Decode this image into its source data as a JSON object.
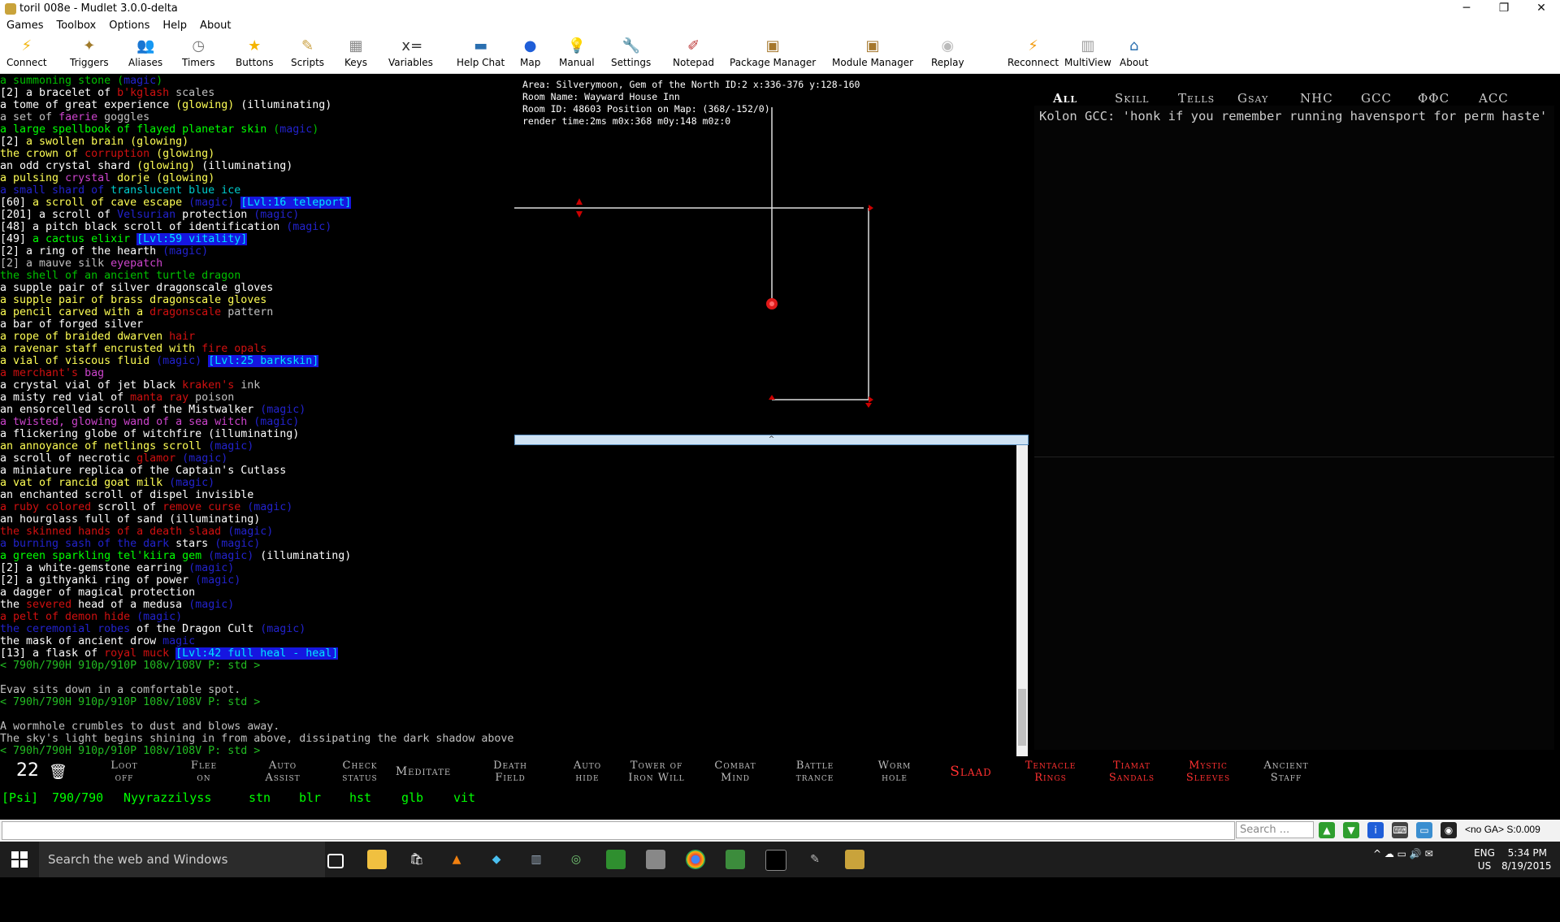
{
  "window": {
    "title": "toril 008e - Mudlet 3.0.0-delta",
    "minimize": "─",
    "maximize": "❐",
    "close": "✕"
  },
  "menu": [
    "Games",
    "Toolbox",
    "Options",
    "Help",
    "About"
  ],
  "toolbar": [
    {
      "label": "Connect",
      "icon": "connect-icon",
      "glyph": "⚡",
      "color": "#f2b40c"
    },
    {
      "label": "Triggers",
      "icon": "triggers-icon",
      "glyph": "✦",
      "color": "#a07a2a"
    },
    {
      "label": "Aliases",
      "icon": "aliases-icon",
      "glyph": "👥",
      "color": "#b88a60"
    },
    {
      "label": "Timers",
      "icon": "timers-icon",
      "glyph": "◷",
      "color": "#777"
    },
    {
      "label": "Buttons",
      "icon": "buttons-icon",
      "glyph": "★",
      "color": "#f4b400"
    },
    {
      "label": "Scripts",
      "icon": "scripts-icon",
      "glyph": "✎",
      "color": "#caa040"
    },
    {
      "label": "Keys",
      "icon": "keys-icon",
      "glyph": "▦",
      "color": "#888"
    },
    {
      "label": "Variables",
      "icon": "variables-icon",
      "glyph": "x=",
      "color": "#333"
    },
    {
      "label": "Help Chat",
      "icon": "help-chat-icon",
      "glyph": "▬",
      "color": "#2a6fb0"
    },
    {
      "label": "Map",
      "icon": "map-icon",
      "glyph": "●",
      "color": "#1f5ed8"
    },
    {
      "label": "Manual",
      "icon": "manual-icon",
      "glyph": "💡",
      "color": "#f2c200"
    },
    {
      "label": "Settings",
      "icon": "settings-icon",
      "glyph": "🔧",
      "color": "#999"
    },
    {
      "label": "Notepad",
      "icon": "notepad-icon",
      "glyph": "✐",
      "color": "#b33"
    },
    {
      "label": "Package Manager",
      "icon": "package-manager-icon",
      "glyph": "▣",
      "color": "#a5772c"
    },
    {
      "label": "Module Manager",
      "icon": "module-manager-icon",
      "glyph": "▣",
      "color": "#a5772c"
    },
    {
      "label": "Replay",
      "icon": "replay-icon",
      "glyph": "◉",
      "color": "#bbb"
    },
    {
      "label": "Reconnect",
      "icon": "reconnect-icon",
      "glyph": "⚡",
      "color": "#f29a0c"
    },
    {
      "label": "MultiView",
      "icon": "multiview-icon",
      "glyph": "▥",
      "color": "#999"
    },
    {
      "label": "About",
      "icon": "about-icon",
      "glyph": "⌂",
      "color": "#2a6fb0"
    }
  ],
  "output_lines": [
    [
      [
        "a summoning stone (",
        "g"
      ],
      [
        "magic",
        "m"
      ],
      [
        ")",
        "g"
      ]
    ],
    [
      [
        "[2] a bracelet of ",
        "w"
      ],
      [
        "b'kglash",
        "r"
      ],
      [
        " scales",
        ""
      ]
    ],
    [
      [
        "a tome of great experience ",
        "w"
      ],
      [
        "(glowing)",
        "y"
      ],
      [
        " (illuminating)",
        "w"
      ]
    ],
    [
      [
        "a set of ",
        ""
      ],
      [
        "faerie",
        "p"
      ],
      [
        " goggles",
        ""
      ]
    ],
    [
      [
        "a large spellbook of flayed planetar skin",
        "gl"
      ],
      [
        " (",
        "g"
      ],
      [
        "magic",
        "m"
      ],
      [
        ")",
        "g"
      ]
    ],
    [
      [
        "[2] ",
        "w"
      ],
      [
        "a swollen brain (glowing)",
        "y"
      ]
    ],
    [
      [
        "the crown of ",
        "y"
      ],
      [
        "corruption",
        "r"
      ],
      [
        " (glowing)",
        "y"
      ]
    ],
    [
      [
        "an odd crystal shard ",
        "w"
      ],
      [
        "(glowing)",
        "y"
      ],
      [
        " (illuminating)",
        "w"
      ]
    ],
    [
      [
        "a pulsing ",
        "y"
      ],
      [
        "crystal",
        "p"
      ],
      [
        " dorje (glowing)",
        "y"
      ]
    ],
    [
      [
        "a small shard of ",
        "m"
      ],
      [
        "translucent blue ice",
        "c"
      ]
    ],
    [
      [
        "[60] ",
        "w"
      ],
      [
        "a scroll of cave escape",
        "y"
      ],
      [
        " (magic) ",
        "m"
      ],
      [
        "[Lvl:16 teleport]",
        "hl"
      ]
    ],
    [
      [
        "[201] a scroll of ",
        "w"
      ],
      [
        "Velsurian",
        "m"
      ],
      [
        " protection ",
        "w"
      ],
      [
        "(magic)",
        "m"
      ]
    ],
    [
      [
        "[48] a pitch black scroll of identification ",
        "w"
      ],
      [
        "(magic)",
        "m"
      ]
    ],
    [
      [
        "[49] ",
        "w"
      ],
      [
        "a cactus elixir",
        "gl"
      ],
      [
        " ",
        ""
      ],
      [
        "[Lvl:59 vitality]",
        "hl"
      ]
    ],
    [
      [
        "[2] a ring of the hearth ",
        "w"
      ],
      [
        "(magic)",
        "m"
      ]
    ],
    [
      [
        "[2] a mauve silk ",
        ""
      ],
      [
        "eyepatch",
        "p"
      ]
    ],
    [
      [
        "the shell of an ancient turtle dragon",
        "g"
      ]
    ],
    [
      [
        "a supple pair of silver dragonscale gloves",
        "w"
      ]
    ],
    [
      [
        "a supple pair of brass dragonscale gloves",
        "y"
      ]
    ],
    [
      [
        "a pencil carved with a ",
        "y"
      ],
      [
        "dragonscale",
        "r"
      ],
      [
        " pattern",
        ""
      ]
    ],
    [
      [
        "a bar of forged silver",
        "w"
      ]
    ],
    [
      [
        "a rope of braided dwarven ",
        "y"
      ],
      [
        "hair",
        "r"
      ]
    ],
    [
      [
        "a ravenar staff encrusted with ",
        "y"
      ],
      [
        "fire opals",
        "r"
      ]
    ],
    [
      [
        "a vial of viscous fluid ",
        "y"
      ],
      [
        "(magic)",
        "m"
      ],
      [
        " ",
        ""
      ],
      [
        "[Lvl:25 barkskin]",
        "hl"
      ]
    ],
    [
      [
        "a merchant's ",
        "r"
      ],
      [
        "bag",
        "p"
      ]
    ],
    [
      [
        "a crystal vial of jet black ",
        "w"
      ],
      [
        "kraken's",
        "r"
      ],
      [
        " ink",
        ""
      ]
    ],
    [
      [
        "a misty red vial of ",
        "w"
      ],
      [
        "manta ray",
        "r"
      ],
      [
        " poison",
        ""
      ]
    ],
    [
      [
        "an ensorcelled scroll of the Mistwalker ",
        "w"
      ],
      [
        "(magic)",
        "m"
      ]
    ],
    [
      [
        "a twisted, glowing wand of a sea witch ",
        "p"
      ],
      [
        "(magic)",
        "m"
      ]
    ],
    [
      [
        "a flickering globe of witchfire (illuminating)",
        "w"
      ]
    ],
    [
      [
        "an annoyance of netlings scroll ",
        "y"
      ],
      [
        "(magic)",
        "m"
      ]
    ],
    [
      [
        "a scroll of necrotic ",
        "w"
      ],
      [
        "glamor",
        "r"
      ],
      [
        " (magic)",
        "m"
      ]
    ],
    [
      [
        "a miniature replica of the Captain's Cutlass",
        "w"
      ]
    ],
    [
      [
        "a vat of rancid goat milk ",
        "y"
      ],
      [
        "(magic)",
        "m"
      ]
    ],
    [
      [
        "an enchanted scroll of dispel invisible",
        "w"
      ]
    ],
    [
      [
        "a ruby colored",
        "r"
      ],
      [
        " scroll of ",
        "w"
      ],
      [
        "remove curse",
        "r"
      ],
      [
        " (magic)",
        "m"
      ]
    ],
    [
      [
        "an hourglass full of sand (illuminating)",
        "w"
      ]
    ],
    [
      [
        "the skinned hands of a death slaad ",
        "r"
      ],
      [
        "(magic)",
        "m"
      ]
    ],
    [
      [
        "a burning sash of the dark ",
        "m"
      ],
      [
        "stars",
        "w"
      ],
      [
        " (magic)",
        "m"
      ]
    ],
    [
      [
        "a green sparkling tel'kiira gem",
        "gl"
      ],
      [
        " (magic)",
        "m"
      ],
      [
        " (illuminating)",
        "w"
      ]
    ],
    [
      [
        "[2] a white-gemstone earring ",
        "w"
      ],
      [
        "(magic)",
        "m"
      ]
    ],
    [
      [
        "[2] a githyanki ring of power ",
        "w"
      ],
      [
        "(magic)",
        "m"
      ]
    ],
    [
      [
        "a dagger of magical protection",
        "w"
      ]
    ],
    [
      [
        "the ",
        "w"
      ],
      [
        "severed",
        "r"
      ],
      [
        " head of a medusa ",
        "w"
      ],
      [
        "(magic)",
        "m"
      ]
    ],
    [
      [
        "a pelt of demon hide ",
        "r"
      ],
      [
        "(magic)",
        "m"
      ]
    ],
    [
      [
        "the ceremonial robes",
        "m"
      ],
      [
        " of the Dragon Cult ",
        "w"
      ],
      [
        "(magic)",
        "m"
      ]
    ],
    [
      [
        "the mask of ancient drow ",
        "w"
      ],
      [
        "magic",
        "m"
      ]
    ],
    [
      [
        "[13] a flask of ",
        "w"
      ],
      [
        "royal muck",
        "r"
      ],
      [
        " ",
        ""
      ],
      [
        "[Lvl:42 full heal - heal]",
        "hl"
      ]
    ],
    [
      [
        "< 790h/790H 910p/910P 108v/108V P: std >",
        "pr"
      ]
    ],
    [
      [
        "",
        ""
      ]
    ],
    [
      [
        "Evav sits down in a comfortable spot.",
        ""
      ]
    ],
    [
      [
        "< 790h/790H 910p/910P 108v/108V P: std >",
        "pr"
      ]
    ],
    [
      [
        "",
        ""
      ]
    ],
    [
      [
        "A wormhole crumbles to dust and blows away.",
        ""
      ]
    ],
    [
      [
        "The sky's light begins shining in from above, dissipating the dark shadow above!",
        ""
      ]
    ],
    [
      [
        "< 790h/790H 910p/910P 108v/108V P: std >",
        "pr"
      ]
    ]
  ],
  "map": {
    "area": "Area: Silverymoon, Gem of the North ID:2 x:336-376 y:128-160",
    "room_name": "Room Name: Wayward House Inn",
    "room_id": "Room ID: 48603 Position on Map: (368/-152/0)",
    "render": "render time:2ms m0x:368 m0y:148 m0z:0",
    "splitter": "^"
  },
  "chat": {
    "tabs": [
      "All",
      "Skill",
      "Tells",
      "Gsay",
      "NHC",
      "GCC",
      "ΦΦC",
      "ACC"
    ],
    "active_tab_color": "#ffffff",
    "message": "Kolon GCC: 'honk if you remember running havensport for perm haste'"
  },
  "counter": {
    "value": "22",
    "icon": "trash-icon",
    "glyph": "🗑"
  },
  "buttons": [
    {
      "line1": "Loot",
      "line2": "off",
      "red": false
    },
    {
      "line1": "Flee",
      "line2": "on",
      "red": false
    },
    {
      "line1": "Auto",
      "line2": "Assist",
      "red": false
    },
    {
      "line1": "Check",
      "line2": "status",
      "red": false
    },
    {
      "line1": "Meditate",
      "line2": "",
      "red": false
    },
    {
      "line1": "Death",
      "line2": "Field",
      "red": false
    },
    {
      "line1": "Auto",
      "line2": "hide",
      "red": false
    },
    {
      "line1": "Tower of",
      "line2": "Iron Will",
      "red": false
    },
    {
      "line1": "Combat",
      "line2": "Mind",
      "red": false
    },
    {
      "line1": "Battle",
      "line2": "trance",
      "red": false
    },
    {
      "line1": "Worm",
      "line2": "hole",
      "red": false
    },
    {
      "line1": "Slaad",
      "line2": "",
      "red": true
    },
    {
      "line1": "Tentacle",
      "line2": "Rings",
      "red": true
    },
    {
      "line1": "Tiamat",
      "line2": "Sandals",
      "red": true
    },
    {
      "line1": "Mystic",
      "line2": "Sleeves",
      "red": true
    },
    {
      "line1": "Ancient",
      "line2": "Staff",
      "red": false
    }
  ],
  "status": {
    "class": "[Psi]",
    "hp": "790/790",
    "name": "Nyyrazzilyss",
    "flags": [
      "stn",
      "blr",
      "hst",
      "glb",
      "vit"
    ]
  },
  "input": {
    "value": "",
    "search_placeholder": "Search ...",
    "ga_text": "<no GA> S:0.009"
  },
  "taskbar": {
    "search": "Search the web and Windows",
    "lang1": "ENG",
    "lang2": "US",
    "time": "5:34 PM",
    "date": "8/19/2015"
  }
}
